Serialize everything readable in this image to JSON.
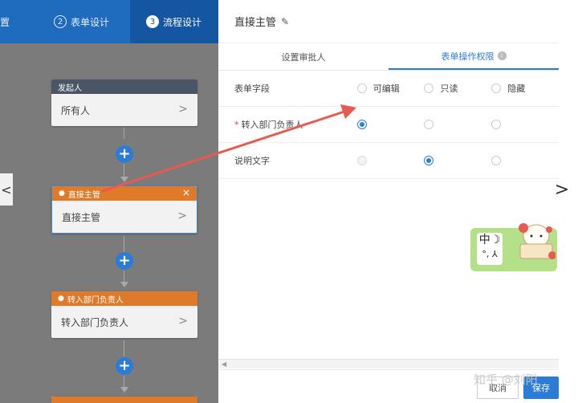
{
  "stepbar": {
    "steps": [
      {
        "num": "",
        "label": "置"
      },
      {
        "num": "2",
        "label": "表单设计"
      },
      {
        "num": "3",
        "label": "流程设计"
      }
    ],
    "active_step": 2
  },
  "flow": {
    "nodes": [
      {
        "type": "starter",
        "header": "发起人",
        "body": "所有人"
      },
      {
        "type": "approver",
        "header": "直接主管",
        "body": "直接主管",
        "selected": true
      },
      {
        "type": "approver",
        "header": "转入部门负责人",
        "body": "转入部门负责人"
      },
      {
        "type": "approver",
        "header": "",
        "body": ""
      }
    ],
    "add_icon": "+",
    "close_icon": "×",
    "chevron": ">",
    "left_nav": "<"
  },
  "panel": {
    "title": "直接主管",
    "edit_icon": "✎",
    "tabs": [
      {
        "label": "设置审批人",
        "active": false
      },
      {
        "label": "表单操作权限",
        "active": true,
        "info": "i"
      }
    ],
    "table": {
      "headers": {
        "field": "表单字段",
        "editable": "可编辑",
        "readonly": "只读",
        "hidden": "隐藏"
      },
      "rows": [
        {
          "field": "转入部门负责人",
          "required": "*",
          "selected": "editable"
        },
        {
          "field": "说明文字",
          "required": "",
          "selected": "readonly",
          "editable_disabled": true
        }
      ]
    },
    "footer": {
      "cancel": "取消",
      "save": "保存"
    }
  },
  "right_nav": ">",
  "sticker": {
    "char": "中",
    "moon": "☽",
    "sub": "°,",
    "butterfly": "⅄"
  },
  "watermark": "知乎 @刘阳",
  "colors": {
    "primary": "#2b7cd6",
    "stepbar": "#1f6bbd",
    "approver": "#e07a2b",
    "starter": "#4a5566",
    "annotation_arrow": "#e85a4f"
  }
}
